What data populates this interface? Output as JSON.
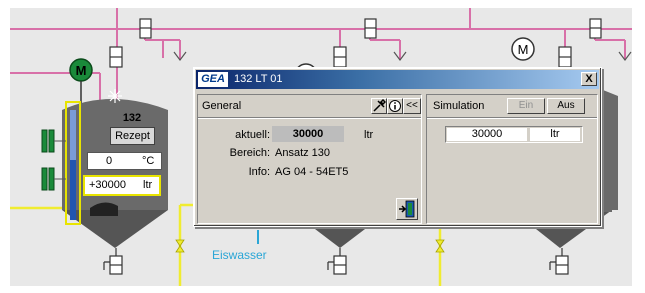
{
  "plant": {
    "tank_number": "132",
    "rezept_label": "Rezept",
    "temperature_value": "0",
    "temperature_unit": "°C",
    "level_value": "+30000",
    "level_unit": "ltr",
    "eiswasser_label": "Eiswasser",
    "motor_label": "M",
    "colors": {
      "pipe": "#d870a8",
      "water": "#2aa6d6",
      "feed": "#f0ec30",
      "tank": "#5a5a5a",
      "motor_green": "#1a8a3a"
    }
  },
  "dialog": {
    "logo": "GEA",
    "title": "132 LT 01",
    "close_label": "X",
    "general": {
      "title": "General",
      "tools_icon": "tools-icon",
      "info_icon": "info-icon",
      "back_label": "<<",
      "fields": {
        "aktuell_label": "aktuell:",
        "aktuell_value": "30000",
        "aktuell_unit": "ltr",
        "bereich_label": "Bereich:",
        "bereich_value": "Ansatz 130",
        "info_label": "Info:",
        "info_value": "AG 04 - 54ET5"
      },
      "exit_icon": "exit-door-icon"
    },
    "simulation": {
      "title": "Simulation",
      "ein_label": "Ein",
      "aus_label": "Aus",
      "value": "30000",
      "unit": "ltr"
    }
  }
}
